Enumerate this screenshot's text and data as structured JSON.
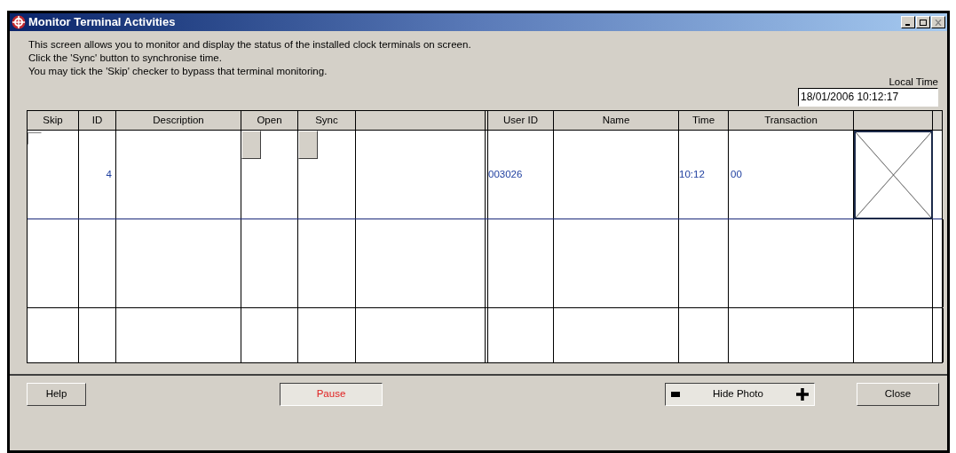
{
  "window": {
    "title": "Monitor Terminal Activities"
  },
  "intro": [
    "This screen allows you to monitor and display the status of the installed clock terminals on screen.",
    "Click the 'Sync' button to synchronise time.",
    "You may tick the 'Skip' checker to bypass that terminal monitoring."
  ],
  "local_time": {
    "label": "Local Time",
    "value": "18/01/2006 10:12:17"
  },
  "table": {
    "columns": [
      "Skip",
      "ID",
      "Description",
      "Open",
      "Sync",
      "",
      "User ID",
      "Name",
      "Time",
      "Transaction",
      ""
    ],
    "rows": [
      {
        "skip_checked": false,
        "id": "4",
        "description": "",
        "user_id": "003026",
        "name": "",
        "time": "10:12",
        "transaction": "00"
      }
    ]
  },
  "buttons": {
    "help": "Help",
    "pause": "Pause",
    "hide_photo": "Hide Photo",
    "close": "Close"
  }
}
